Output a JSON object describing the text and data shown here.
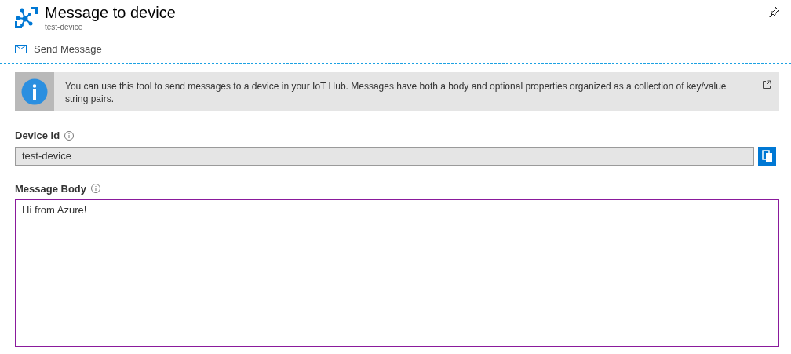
{
  "header": {
    "title": "Message to device",
    "subtitle": "test-device"
  },
  "toolbar": {
    "send_button": "Send Message"
  },
  "info": {
    "text": "You can use this tool to send messages to a device in your IoT Hub. Messages have both a body and optional properties organized as a collection of key/value string pairs."
  },
  "device_id": {
    "label": "Device Id",
    "value": "test-device"
  },
  "message_body": {
    "label": "Message Body",
    "value": "Hi from Azure!"
  }
}
